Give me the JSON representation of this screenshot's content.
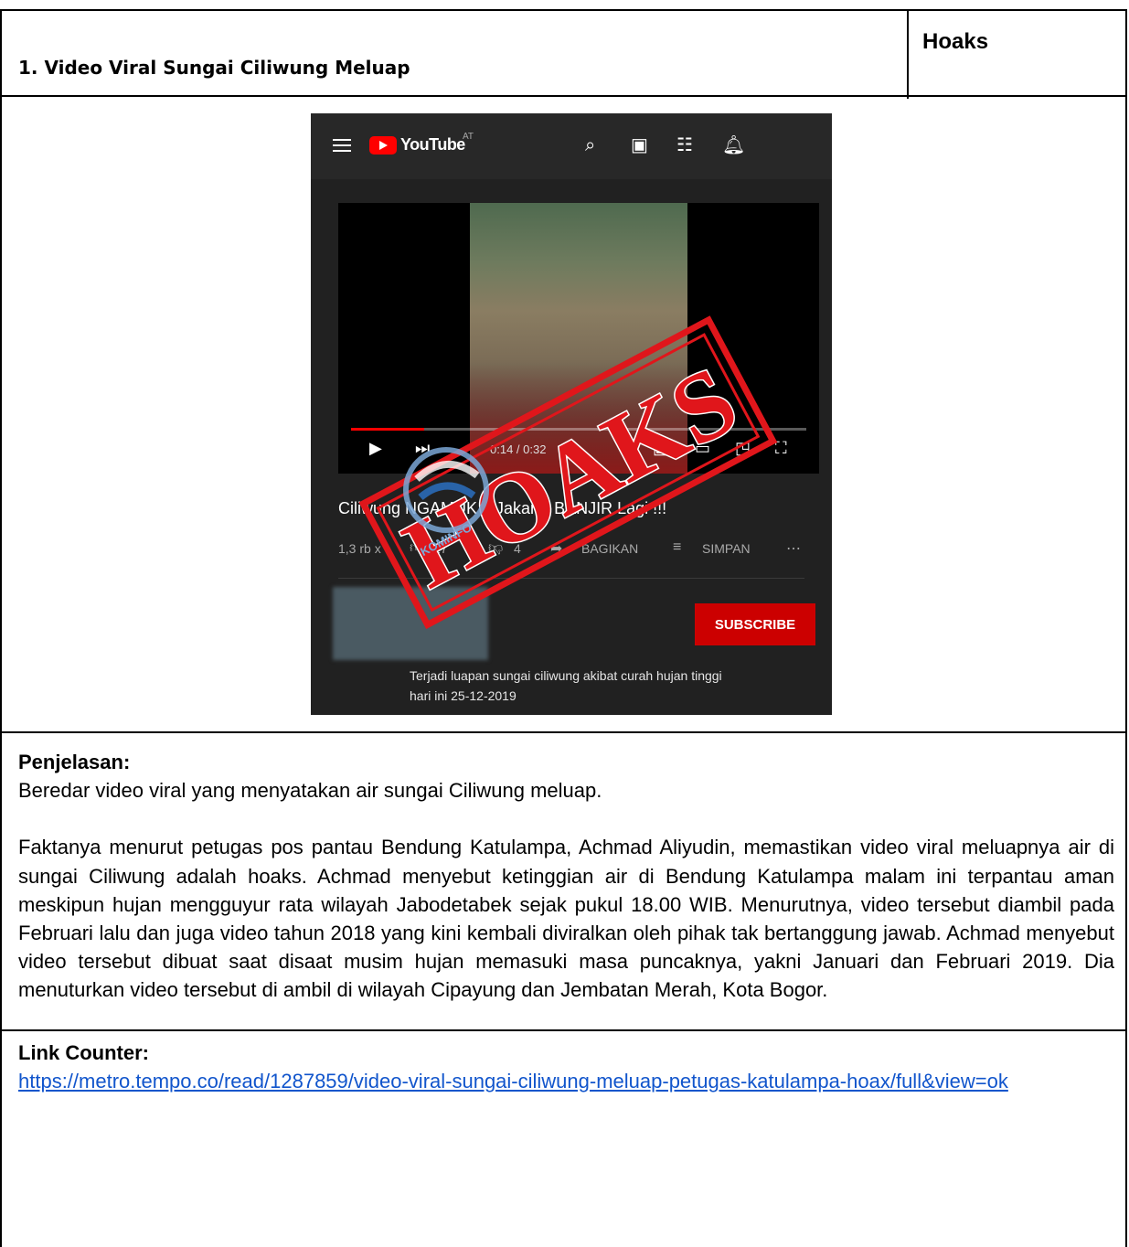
{
  "header": {
    "title": "1. Video Viral Sungai Ciliwung Meluap",
    "verdict": "Hoaks"
  },
  "screenshot": {
    "brand": "YouTube",
    "region": "AT",
    "stamp_text": "HOAKS",
    "watermark_text": "KOMINFO",
    "player": {
      "time": "0:14 / 0:32",
      "progress_fraction": 0.16
    },
    "video_title": "Ciliwung NGAMUK !! Jakarta BANJIR Lagi !!!",
    "views": "1,3 rb x",
    "likes": "27",
    "dislikes": "4",
    "share_label": "BAGIKAN",
    "save_label": "SIMPAN",
    "subscribe_label": "SUBSCRIBE",
    "description_line1": "Terjadi luapan sungai ciliwung akibat curah hujan tinggi",
    "description_line2": "hari ini 25-12-2019",
    "colors": {
      "brand_red": "#ff0000",
      "subscribe_red": "#cc0000",
      "stamp_red": "#e0161b"
    }
  },
  "explanation": {
    "heading": "Penjelasan:",
    "paragraph1": "Beredar video viral yang menyatakan air sungai Ciliwung meluap.",
    "paragraph2": "Faktanya menurut petugas pos pantau Bendung Katulampa, Achmad Aliyudin, memastikan video viral meluapnya air di sungai Ciliwung adalah hoaks. Achmad menyebut ketinggian air di Bendung Katulampa malam ini terpantau aman meskipun hujan mengguyur rata wilayah Jabodetabek sejak pukul 18.00 WIB. Menurutnya, video tersebut diambil pada Februari lalu dan juga video tahun 2018 yang kini kembali diviralkan oleh pihak tak bertanggung jawab. Achmad menyebut video tersebut dibuat saat disaat musim hujan memasuki masa puncaknya, yakni Januari dan Februari 2019. Dia menuturkan video tersebut di ambil di wilayah Cipayung dan Jembatan Merah, Kota Bogor."
  },
  "counter": {
    "heading": "Link Counter:",
    "link_text": "https://metro.tempo.co/read/1287859/video-viral-sungai-ciliwung-meluap-petugas-katulampa-hoax/full&view=ok"
  }
}
